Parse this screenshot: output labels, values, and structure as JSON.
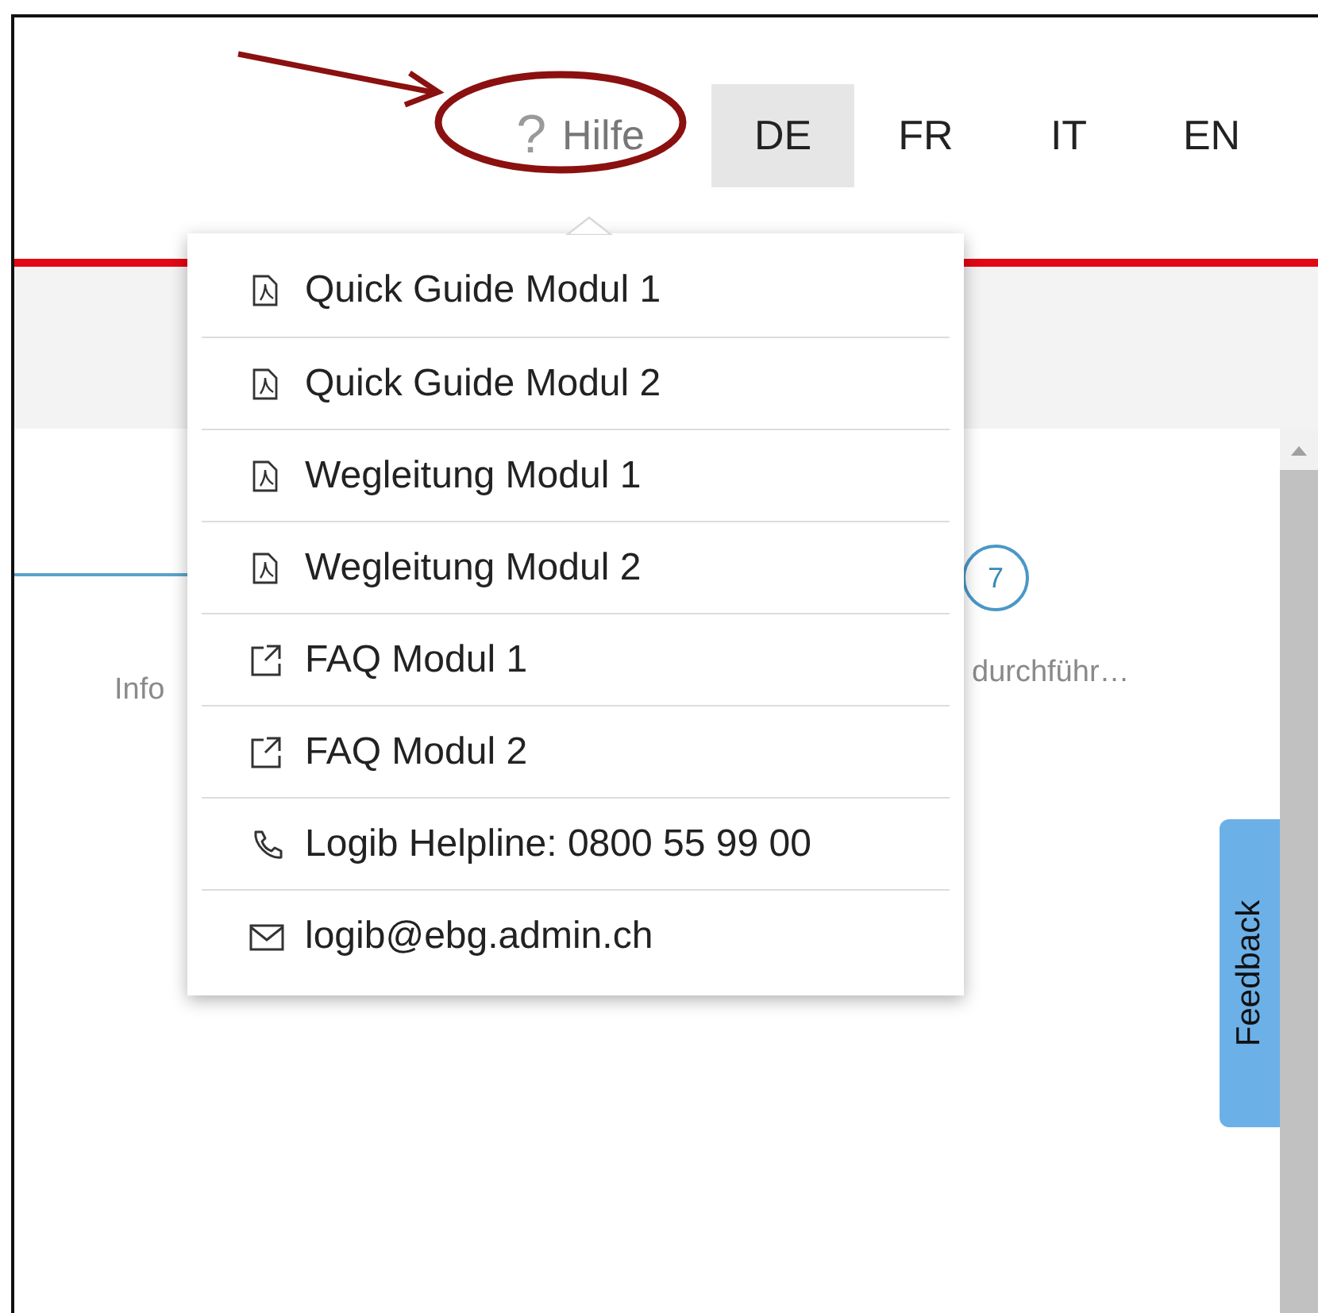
{
  "header": {
    "help": {
      "icon": "?",
      "label": "Hilfe"
    },
    "languages": [
      {
        "label": "DE",
        "selected": true
      },
      {
        "label": "FR",
        "selected": false
      },
      {
        "label": "IT",
        "selected": false
      },
      {
        "label": "EN",
        "selected": false
      }
    ]
  },
  "help_menu": {
    "items": [
      {
        "kind": "pdf",
        "label": "Quick Guide Modul 1"
      },
      {
        "kind": "pdf",
        "label": "Quick Guide Modul 2"
      },
      {
        "kind": "pdf",
        "label": "Wegleitung Modul 1"
      },
      {
        "kind": "pdf",
        "label": "Wegleitung Modul 2"
      },
      {
        "kind": "external",
        "label": "FAQ Modul 1"
      },
      {
        "kind": "external",
        "label": "FAQ Modul 2"
      },
      {
        "kind": "phone",
        "label": "Logib Helpline: 0800 55 99 00"
      },
      {
        "kind": "mail",
        "label": "logib@ebg.admin.ch"
      }
    ]
  },
  "stepper": {
    "steps": [
      {
        "label": "Info"
      },
      {
        "number": "7",
        "label": "durchführ…"
      }
    ]
  },
  "feedback": {
    "label": "Feedback"
  }
}
